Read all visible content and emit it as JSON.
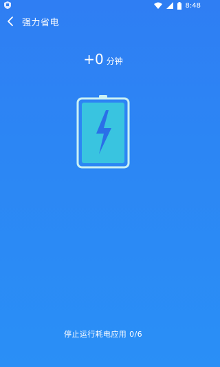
{
  "statusbar": {
    "time": "8:48"
  },
  "header": {
    "title": "强力省电"
  },
  "boost": {
    "value": "+0",
    "unit": "分钟"
  },
  "footer": {
    "text": "停止运行耗电应用 0/6"
  }
}
